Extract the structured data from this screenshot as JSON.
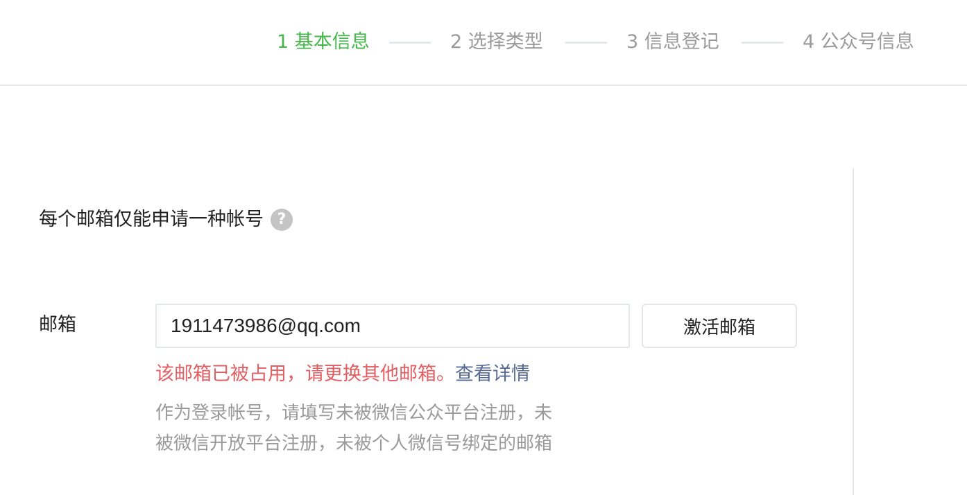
{
  "steps": [
    {
      "label": "1 基本信息",
      "active": true
    },
    {
      "label": "2 选择类型",
      "active": false
    },
    {
      "label": "3 信息登记",
      "active": false
    },
    {
      "label": "4 公众号信息",
      "active": false
    }
  ],
  "colors": {
    "active_step": "#44b549",
    "inactive_step": "#9a9a9a",
    "error": "#e15f63",
    "link": "#576b95"
  },
  "notice": {
    "text": "每个邮箱仅能申请一种帐号",
    "help_icon": "help-icon",
    "help_glyph": "?"
  },
  "form": {
    "email_label": "邮箱",
    "email_value": "1911473986@qq.com",
    "activate_button": "激活邮箱",
    "error_text": "该邮箱已被占用，请更换其他邮箱。",
    "detail_link": "查看详情",
    "hint_line1": "作为登录帐号，请填写未被微信公众平台注册，未",
    "hint_line2": "被微信开放平台注册，未被个人微信号绑定的邮箱"
  }
}
